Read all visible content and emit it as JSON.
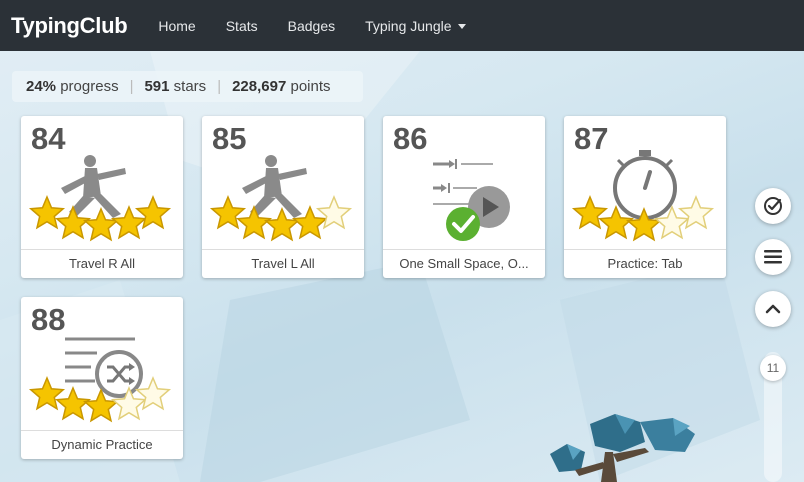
{
  "navbar": {
    "brand": "TypingClub",
    "items": [
      {
        "label": "Home"
      },
      {
        "label": "Stats"
      },
      {
        "label": "Badges"
      },
      {
        "label": "Typing Jungle"
      }
    ]
  },
  "stats": {
    "progress_value": "24%",
    "progress_label": "progress",
    "stars_value": "591",
    "stars_label": "stars",
    "points_value": "228,697",
    "points_label": "points"
  },
  "lessons": [
    {
      "number": "84",
      "label": "Travel R All",
      "stars": 5,
      "icon": "yoga-pose-icon"
    },
    {
      "number": "85",
      "label": "Travel L All",
      "stars": 4,
      "icon": "yoga-pose-icon"
    },
    {
      "number": "86",
      "label": "One Small Space, O...",
      "stars": 0,
      "icon": "video-lesson-icon",
      "completed": true
    },
    {
      "number": "87",
      "label": "Practice: Tab",
      "stars": 3,
      "icon": "stopwatch-icon"
    },
    {
      "number": "88",
      "label": "Dynamic Practice",
      "stars": 3,
      "icon": "shuffle-list-icon"
    }
  ],
  "side": {
    "scroll_indicator": "11"
  },
  "colors": {
    "navbar": "#2b3137",
    "star_fill": "#f5c400",
    "check_green": "#5bb031",
    "icon_gray": "#8a8a8a"
  }
}
